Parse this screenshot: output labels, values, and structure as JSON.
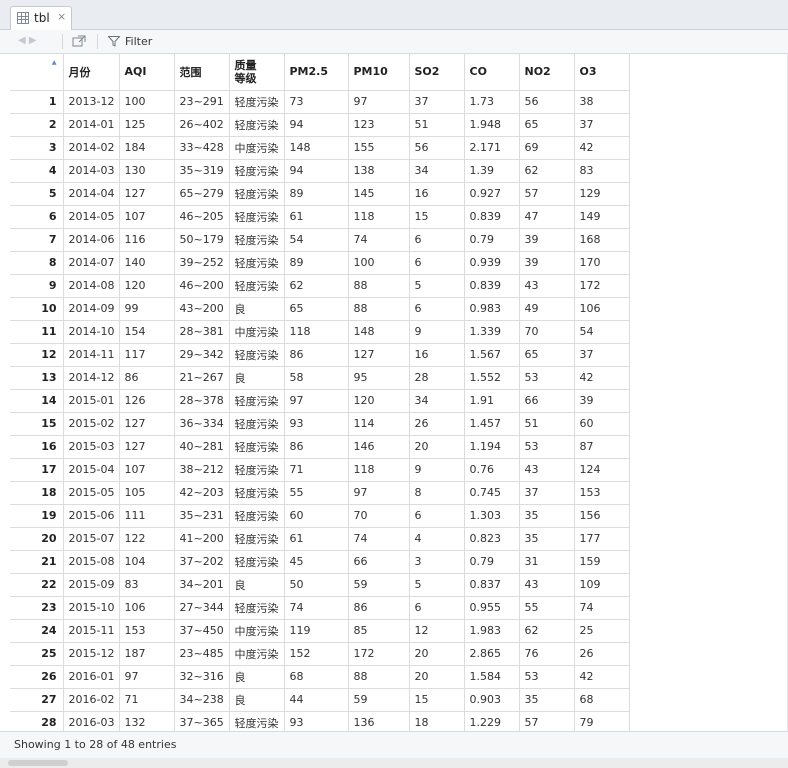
{
  "tab": {
    "label": "tbl",
    "close": "×"
  },
  "toolbar": {
    "filter_label": "Filter"
  },
  "table": {
    "columns": [
      "月份",
      "AQI",
      "范围",
      "质量\n等级",
      "PM2.5",
      "PM10",
      "SO2",
      "CO",
      "NO2",
      "O3"
    ],
    "rows": [
      [
        "1",
        "2013-12",
        "100",
        "23~291",
        "轻度污染",
        "73",
        "97",
        "37",
        "1.73",
        "56",
        "38"
      ],
      [
        "2",
        "2014-01",
        "125",
        "26~402",
        "轻度污染",
        "94",
        "123",
        "51",
        "1.948",
        "65",
        "37"
      ],
      [
        "3",
        "2014-02",
        "184",
        "33~428",
        "中度污染",
        "148",
        "155",
        "56",
        "2.171",
        "69",
        "42"
      ],
      [
        "4",
        "2014-03",
        "130",
        "35~319",
        "轻度污染",
        "94",
        "138",
        "34",
        "1.39",
        "62",
        "83"
      ],
      [
        "5",
        "2014-04",
        "127",
        "65~279",
        "轻度污染",
        "89",
        "145",
        "16",
        "0.927",
        "57",
        "129"
      ],
      [
        "6",
        "2014-05",
        "107",
        "46~205",
        "轻度污染",
        "61",
        "118",
        "15",
        "0.839",
        "47",
        "149"
      ],
      [
        "7",
        "2014-06",
        "116",
        "50~179",
        "轻度污染",
        "54",
        "74",
        "6",
        "0.79",
        "39",
        "168"
      ],
      [
        "8",
        "2014-07",
        "140",
        "39~252",
        "轻度污染",
        "89",
        "100",
        "6",
        "0.939",
        "39",
        "170"
      ],
      [
        "9",
        "2014-08",
        "120",
        "46~200",
        "轻度污染",
        "62",
        "88",
        "5",
        "0.839",
        "43",
        "172"
      ],
      [
        "10",
        "2014-09",
        "99",
        "43~200",
        "良",
        "65",
        "88",
        "6",
        "0.983",
        "49",
        "106"
      ],
      [
        "11",
        "2014-10",
        "154",
        "28~381",
        "中度污染",
        "118",
        "148",
        "9",
        "1.339",
        "70",
        "54"
      ],
      [
        "12",
        "2014-11",
        "117",
        "29~342",
        "轻度污染",
        "86",
        "127",
        "16",
        "1.567",
        "65",
        "37"
      ],
      [
        "13",
        "2014-12",
        "86",
        "21~267",
        "良",
        "58",
        "95",
        "28",
        "1.552",
        "53",
        "42"
      ],
      [
        "14",
        "2015-01",
        "126",
        "28~378",
        "轻度污染",
        "97",
        "120",
        "34",
        "1.91",
        "66",
        "39"
      ],
      [
        "15",
        "2015-02",
        "127",
        "36~334",
        "轻度污染",
        "93",
        "114",
        "26",
        "1.457",
        "51",
        "60"
      ],
      [
        "16",
        "2015-03",
        "127",
        "40~281",
        "轻度污染",
        "86",
        "146",
        "20",
        "1.194",
        "53",
        "87"
      ],
      [
        "17",
        "2015-04",
        "107",
        "38~212",
        "轻度污染",
        "71",
        "118",
        "9",
        "0.76",
        "43",
        "124"
      ],
      [
        "18",
        "2015-05",
        "105",
        "42~203",
        "轻度污染",
        "55",
        "97",
        "8",
        "0.745",
        "37",
        "153"
      ],
      [
        "19",
        "2015-06",
        "111",
        "35~231",
        "轻度污染",
        "60",
        "70",
        "6",
        "1.303",
        "35",
        "156"
      ],
      [
        "20",
        "2015-07",
        "122",
        "41~200",
        "轻度污染",
        "61",
        "74",
        "4",
        "0.823",
        "35",
        "177"
      ],
      [
        "21",
        "2015-08",
        "104",
        "37~202",
        "轻度污染",
        "45",
        "66",
        "3",
        "0.79",
        "31",
        "159"
      ],
      [
        "22",
        "2015-09",
        "83",
        "34~201",
        "良",
        "50",
        "59",
        "5",
        "0.837",
        "43",
        "109"
      ],
      [
        "23",
        "2015-10",
        "106",
        "27~344",
        "轻度污染",
        "74",
        "86",
        "6",
        "0.955",
        "55",
        "74"
      ],
      [
        "24",
        "2015-11",
        "153",
        "37~450",
        "中度污染",
        "119",
        "85",
        "12",
        "1.983",
        "62",
        "25"
      ],
      [
        "25",
        "2015-12",
        "187",
        "23~485",
        "中度污染",
        "152",
        "172",
        "20",
        "2.865",
        "76",
        "26"
      ],
      [
        "26",
        "2016-01",
        "97",
        "32~316",
        "良",
        "68",
        "88",
        "20",
        "1.584",
        "53",
        "42"
      ],
      [
        "27",
        "2016-02",
        "71",
        "34~238",
        "良",
        "44",
        "59",
        "15",
        "0.903",
        "35",
        "68"
      ],
      [
        "28",
        "2016-03",
        "132",
        "37~365",
        "轻度污染",
        "93",
        "136",
        "18",
        "1.229",
        "57",
        "79"
      ]
    ]
  },
  "status": {
    "text": "Showing 1 to 28 of 48 entries"
  },
  "icons": {
    "sort": "sort-arrow-icon",
    "filter": "filter-icon",
    "popout": "popout-icon",
    "back": "back-forward-icon"
  }
}
